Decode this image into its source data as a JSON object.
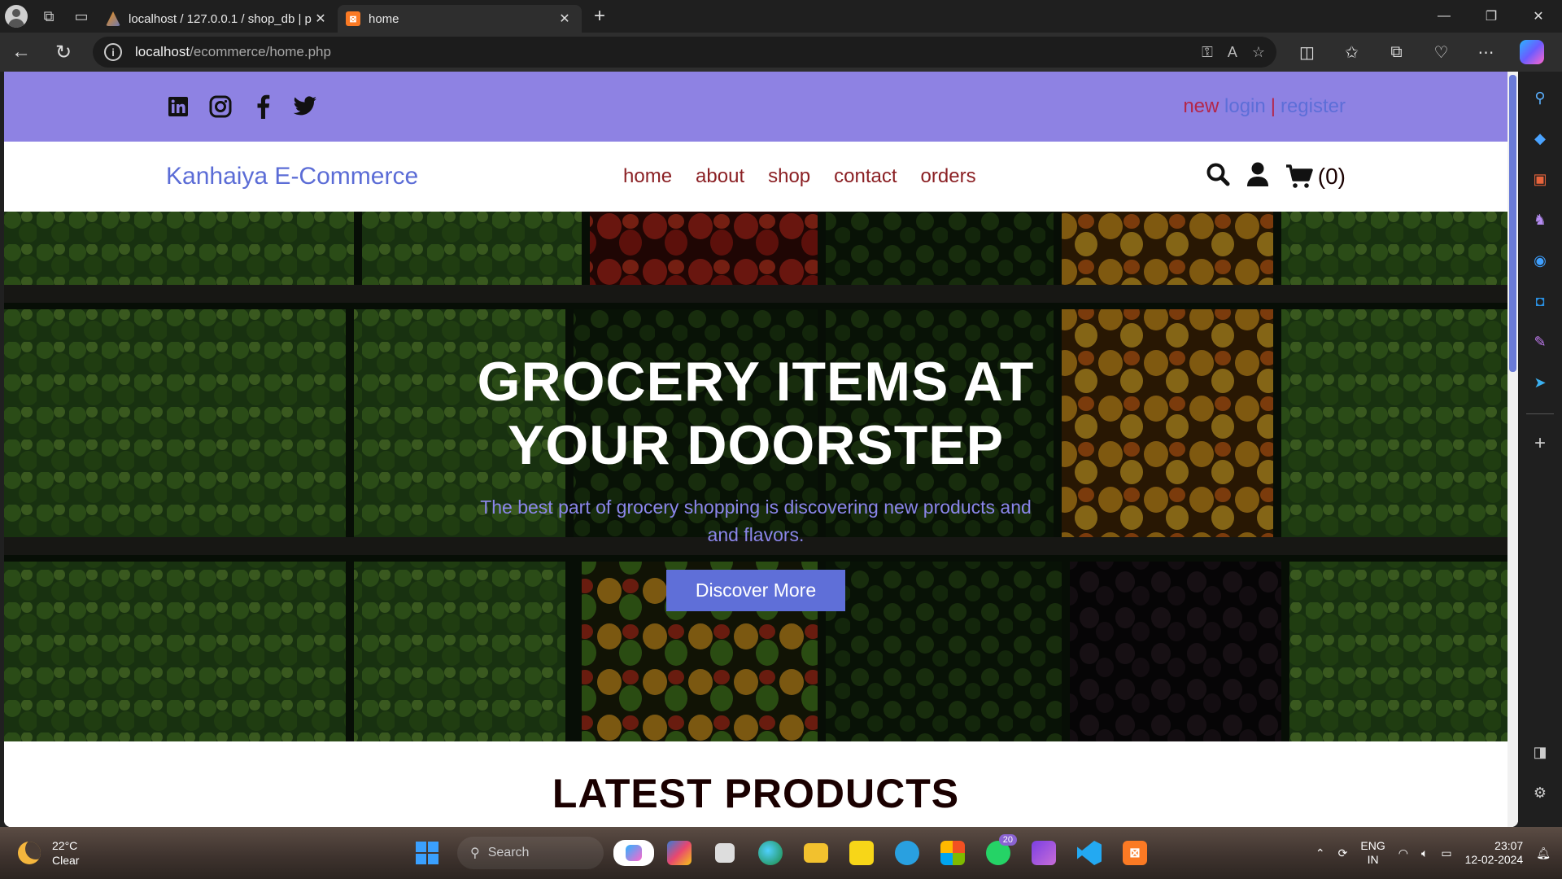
{
  "browser": {
    "tabs": [
      {
        "title": "localhost / 127.0.0.1 / shop_db | p",
        "active": false
      },
      {
        "title": "home",
        "active": true
      }
    ],
    "url_host": "localhost",
    "url_path": "/ecommerce/home.php"
  },
  "site": {
    "topbar": {
      "socials": [
        "linkedin-icon",
        "instagram-icon",
        "facebook-icon",
        "twitter-icon"
      ],
      "new_label": "new",
      "login_label": "login",
      "separator": "|",
      "register_label": "register"
    },
    "header": {
      "logo": "Kanhaiya E-Commerce",
      "nav": [
        "home",
        "about",
        "shop",
        "contact",
        "orders"
      ],
      "cart_count": "(0)"
    },
    "hero": {
      "title_line1": "GROCERY ITEMS AT",
      "title_line2": "YOUR DOORSTEP",
      "subtitle": "The best part of grocery shopping is discovering new products and and flavors.",
      "button": "Discover More"
    },
    "latest_title": "LATEST PRODUCTS"
  },
  "taskbar": {
    "weather_temp": "22°C",
    "weather_desc": "Clear",
    "search_placeholder": "Search",
    "whatsapp_badge": "20",
    "lang_line1": "ENG",
    "lang_line2": "IN",
    "time": "23:07",
    "date": "12-02-2024"
  },
  "colors": {
    "topbar": "#8e82e3",
    "accent": "#5f6fd8",
    "nav_link": "#8b2024"
  }
}
